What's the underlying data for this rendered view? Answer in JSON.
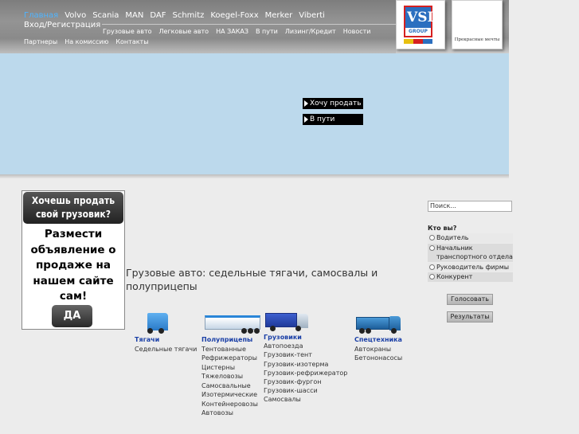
{
  "header": {
    "topnav": [
      "Главная",
      "Volvo",
      "Scania",
      "MAN",
      "DAF",
      "Schmitz",
      "Koegel-Foxx",
      "Merker",
      "Viberti"
    ],
    "login": "Вход/Регистрация",
    "subnav_row1": [
      "Грузовые авто",
      "Легковые авто",
      "НА ЗАКАЗ",
      "В пути",
      "Лизинг/Кредит",
      "Новости"
    ],
    "subnav_row2": [
      "Партнеры",
      "На комиссию",
      "Контакты"
    ],
    "logo_letters": "VSI",
    "logo_group": "GROUP",
    "slogan": "Прекрасные мечты"
  },
  "banner": {
    "sell_label": "Хочу продать",
    "transit_label": "В пути"
  },
  "promo": {
    "title": "Хочешь продать свой грузовик?",
    "body": "Размести объявление о продаже на нашем сайте сам!",
    "button": "ДА"
  },
  "main": {
    "heading": "Грузовые авто: седельные тягачи, самосвалы и полуприцепы",
    "categories": [
      {
        "title": "Тягачи",
        "items": [
          "Седельные тягачи"
        ]
      },
      {
        "title": "Полуприцепы",
        "items": [
          "Тентованные",
          "Рефрижераторы",
          "Цистерны",
          "Тяжеловозы",
          "Самосвальные",
          "Изотермические",
          "Контейнеровозы",
          "Автовозы"
        ]
      },
      {
        "title": "Грузовики",
        "items": [
          "Автопоезда",
          "Грузовик-тент",
          "Грузовик-изотерма",
          "Грузовик-рефрижератор",
          "Грузовик-фургон",
          "Грузовик-шасси",
          "Самосвалы"
        ]
      },
      {
        "title": "Спецтехника",
        "items": [
          "Автокраны",
          "Бетононасосы"
        ]
      }
    ]
  },
  "sidebar": {
    "search_placeholder": "Поиск...",
    "poll_question": "Кто вы?",
    "poll_options": [
      "Водитель",
      "Начальник транспортного отдела",
      "Руководитель фирмы",
      "Конкурент"
    ],
    "vote_button": "Голосовать",
    "results_button": "Результаты"
  },
  "colors": {
    "active_nav": "#4fb4ff",
    "banner_bg": "#bcd9ec",
    "category_title": "#1a3fa6"
  }
}
